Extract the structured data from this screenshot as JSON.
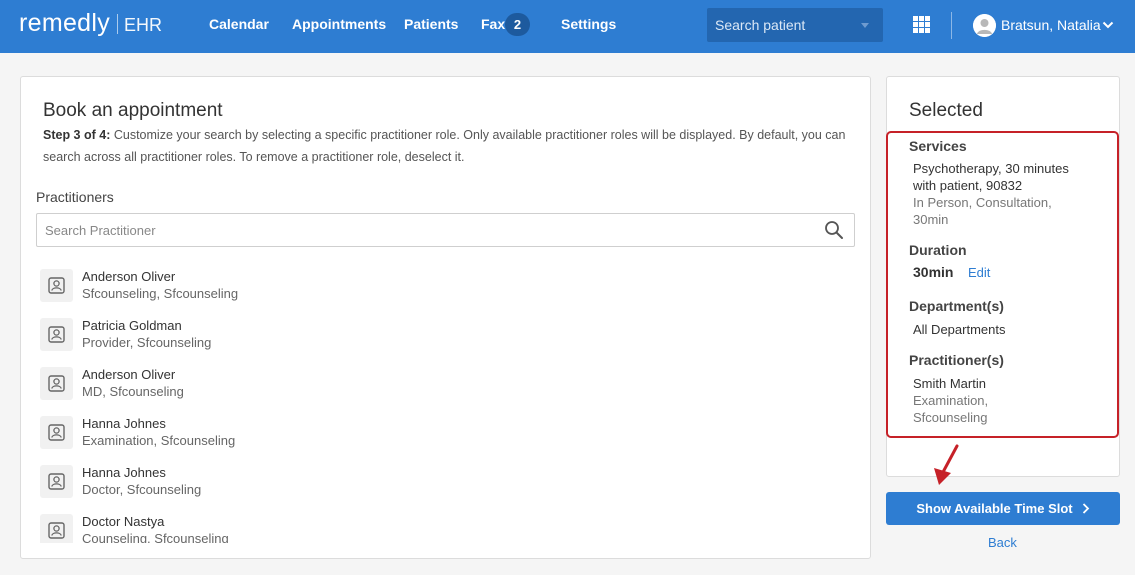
{
  "app": {
    "logo": "remedly",
    "logo_suffix": "EHR"
  },
  "nav": {
    "items": [
      {
        "label": "Calendar"
      },
      {
        "label": "Appointments"
      },
      {
        "label": "Patients"
      },
      {
        "label": "Fax"
      },
      {
        "label": "Settings"
      }
    ],
    "fax_badge": "2",
    "search_placeholder": "Search patient",
    "user_name": "Bratsun, Natalia"
  },
  "main": {
    "title": "Book an appointment",
    "step_label": "Step 3 of 4:",
    "step_text": " Customize your search by selecting a specific practitioner role. Only available practitioner roles will be displayed. By default, you can search across all practitioner roles. To remove a practitioner role, deselect it.",
    "practitioners_label": "Practitioners",
    "search_placeholder": "Search Practitioner",
    "practitioners": [
      {
        "name": "Anderson Oliver",
        "roles": "Sfcounseling, Sfcounseling"
      },
      {
        "name": "Patricia Goldman",
        "roles": "Provider, Sfcounseling"
      },
      {
        "name": "Anderson Oliver",
        "roles": "MD, Sfcounseling"
      },
      {
        "name": "Hanna Johnes",
        "roles": "Examination, Sfcounseling"
      },
      {
        "name": "Hanna Johnes",
        "roles": "Doctor, Sfcounseling"
      },
      {
        "name": "Doctor Nastya",
        "roles": "Counseling, Sfcounseling"
      }
    ]
  },
  "selected": {
    "title": "Selected",
    "services_label": "Services",
    "service_name_line1": "Psychotherapy, 30 minutes",
    "service_name_line2": "with patient, 90832",
    "service_detail_line1": "In Person, Consultation,",
    "service_detail_line2": "30min",
    "duration_label": "Duration",
    "duration_value": "30min",
    "edit_label": "Edit",
    "departments_label": "Department(s)",
    "departments_value": "All Departments",
    "practitioners_label": "Practitioner(s)",
    "practitioner_name": "Smith Martin",
    "practitioner_role_line1": "Examination,",
    "practitioner_role_line2": "Sfcounseling"
  },
  "actions": {
    "show_slot": "Show Available Time Slot",
    "back": "Back"
  },
  "colors": {
    "brand_blue": "#2e7dd2",
    "highlight_red": "#c62128"
  },
  "icons": {
    "search": "magnifier-icon",
    "apps": "grid-icon",
    "user": "avatar-icon",
    "chevron": "chevron-down-icon",
    "practitioner": "user-card-icon",
    "arrow": "red-arrow-icon"
  }
}
